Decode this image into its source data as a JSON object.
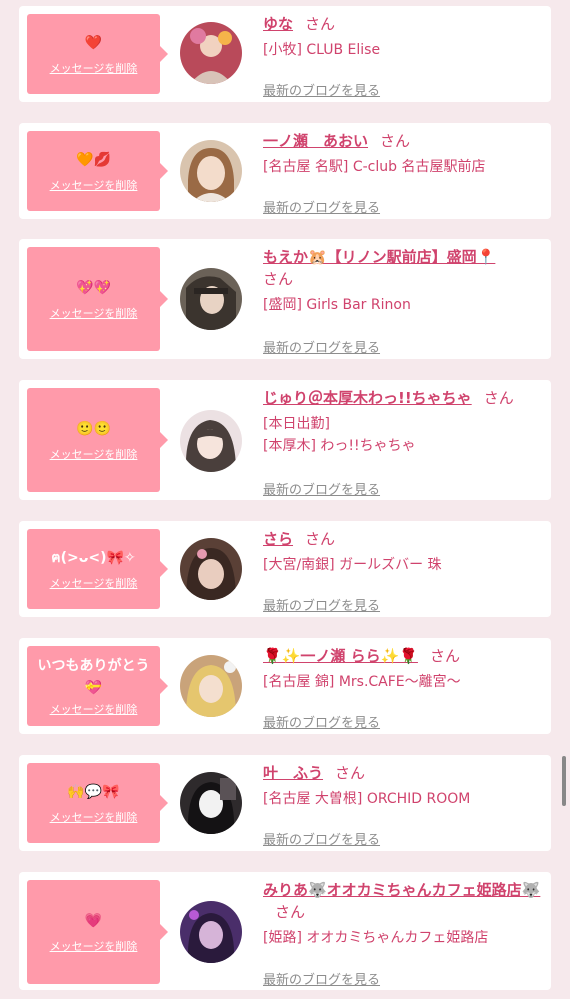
{
  "common": {
    "delete_label": "メッセージを削除",
    "blog_label": "最新のブログを見る",
    "honorific": "さん"
  },
  "items": [
    {
      "message": "❤️",
      "name": "ゆな",
      "shop": "[小牧] CLUB Elise",
      "avatar_color": "#b94a5a"
    },
    {
      "message": "🧡💋",
      "name": "一ノ瀬　あおい",
      "shop": "[名古屋 名駅] C-club 名古屋駅前店",
      "avatar_color": "#c7a58a"
    },
    {
      "message": "💖💖",
      "name": "もえか🐹【リノン駅前店】盛岡📍",
      "shop": "[盛岡] Girls Bar Rinon",
      "avatar_color": "#6b6258"
    },
    {
      "message": "🙂🙂",
      "name": "じゅり＠本厚木わっ!!ちゃちゃ",
      "shop_pre": "[本日出勤]",
      "shop": "[本厚木] わっ!!ちゃちゃ",
      "avatar_color": "#e0c9cc"
    },
    {
      "message": "ฅ(>ᴗ<)🎀✧",
      "name": "さら",
      "shop": "[大宮/南銀] ガールズバー 珠",
      "avatar_color": "#5a4036"
    },
    {
      "message": "いつもありがとう💝",
      "name": "🌹✨一ノ瀬 らら✨🌹",
      "shop": "[名古屋 錦] Mrs.CAFE〜離宮〜",
      "avatar_color": "#c9a37a"
    },
    {
      "message": "🙌💬🎀",
      "name": "叶　ふう",
      "shop": "[名古屋 大曽根] ORCHID ROOM",
      "avatar_color": "#2e2a2c"
    },
    {
      "message": "💗",
      "name": "みりあ🐺オオカミちゃんカフェ姫路店🐺",
      "shop": "[姫路] オオカミちゃんカフェ姫路店",
      "avatar_color": "#4a2e6a"
    }
  ]
}
